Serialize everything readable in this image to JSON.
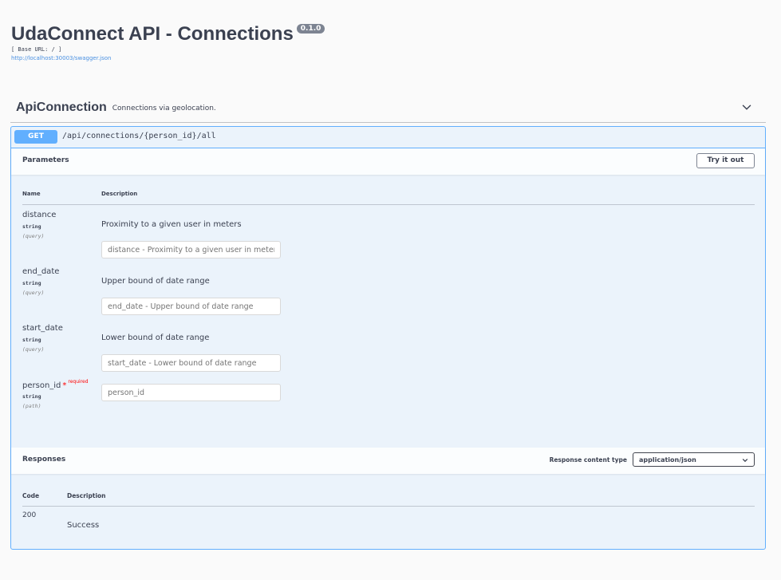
{
  "header": {
    "title": "UdaConnect API - Connections",
    "version": "0.1.0",
    "base_url": "[ Base URL: / ]",
    "spec_link": "http://localhost:30003/swagger.json"
  },
  "tag": {
    "name": "ApiConnection",
    "description": "Connections via geolocation.",
    "expanded_icon": "chevron-up-icon"
  },
  "operation": {
    "method": "GET",
    "path": "/api/connections/{person_id}/all",
    "method_color": "#61affe"
  },
  "parameters_section": {
    "title": "Parameters",
    "try_button": "Try it out",
    "col_name": "Name",
    "col_description": "Description",
    "params": [
      {
        "name": "distance",
        "type": "string",
        "in": "(query)",
        "required": false,
        "description": "Proximity to a given user in meters",
        "placeholder": "distance - Proximity to a given user in meters"
      },
      {
        "name": "end_date",
        "type": "string",
        "in": "(query)",
        "required": false,
        "description": "Upper bound of date range",
        "placeholder": "end_date - Upper bound of date range"
      },
      {
        "name": "start_date",
        "type": "string",
        "in": "(query)",
        "required": false,
        "description": "Lower bound of date range",
        "placeholder": "start_date - Lower bound of date range"
      },
      {
        "name": "person_id",
        "type": "string",
        "in": "(path)",
        "required": true,
        "required_star": "*",
        "required_label": "required",
        "description": "",
        "placeholder": "person_id"
      }
    ]
  },
  "responses_section": {
    "title": "Responses",
    "content_type_label": "Response content type",
    "content_type_value": "application/json",
    "col_code": "Code",
    "col_description": "Description",
    "rows": [
      {
        "code": "200",
        "description": "Success"
      }
    ]
  }
}
